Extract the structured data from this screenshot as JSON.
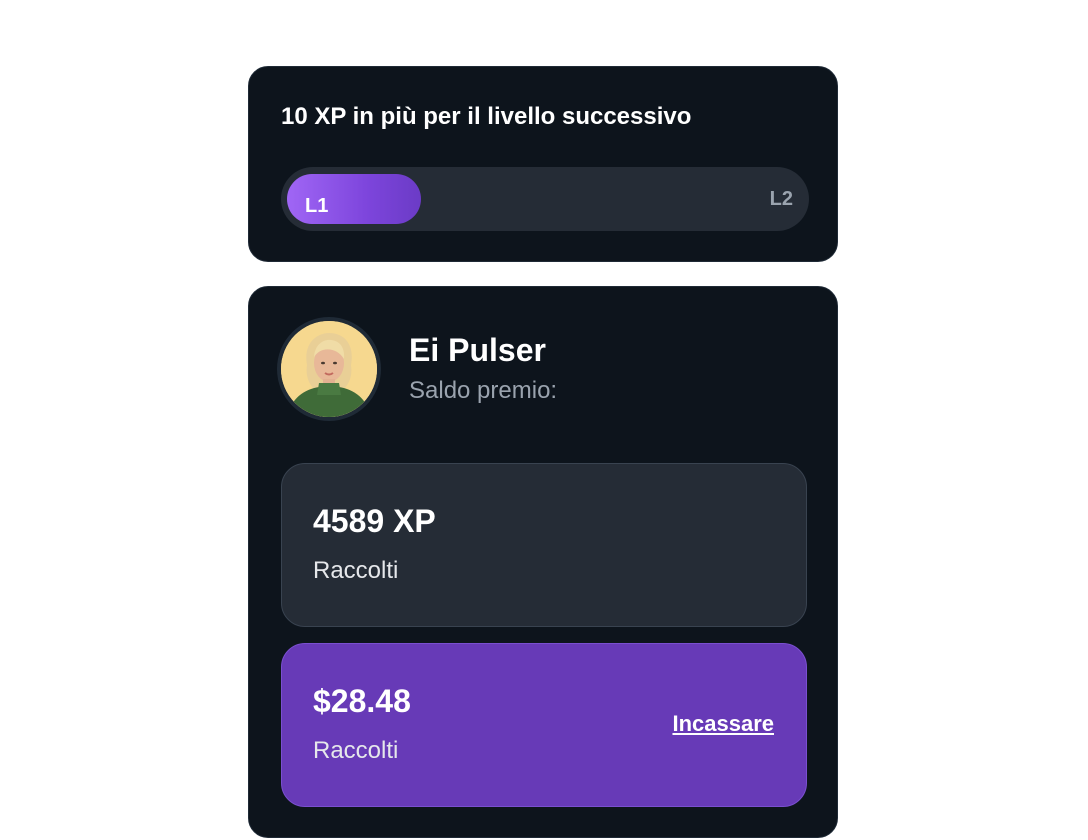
{
  "progress": {
    "title": "10 XP in più per il livello successivo",
    "current_level": "L1",
    "next_level": "L2",
    "fill_fraction": 0.26,
    "fill_color": "#8b55e8"
  },
  "profile": {
    "name": "Ei Pulser",
    "balance_label": "Saldo premio:",
    "avatar_icon": "user-avatar-photo"
  },
  "xp": {
    "value": "4589 XP",
    "label": "Raccolti"
  },
  "cash": {
    "value": "$28.48",
    "label": "Raccolti",
    "action_label": "Incassare",
    "color": "#673ab7"
  }
}
